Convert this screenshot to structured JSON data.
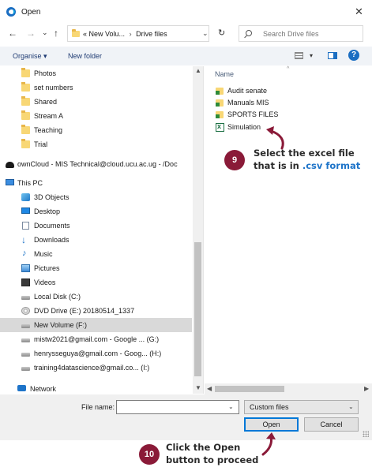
{
  "window": {
    "title": "Open",
    "close_glyph": "✕"
  },
  "nav": {
    "back": "←",
    "forward": "→",
    "recent": "⌄",
    "up": "↑",
    "address_segments": [
      "«",
      "New Volu...",
      "›",
      "Drive files"
    ],
    "refresh": "↻",
    "search_placeholder": "Search Drive files"
  },
  "toolbar": {
    "organise": "Organise ▾",
    "new_folder": "New folder",
    "view_dd": "▾",
    "help": "?"
  },
  "sidebar": {
    "items": [
      {
        "label": "Photos",
        "icon": "folder-icon"
      },
      {
        "label": "set numbers",
        "icon": "folder-icon"
      },
      {
        "label": "Shared",
        "icon": "folder-icon"
      },
      {
        "label": "Stream A",
        "icon": "folder-icon"
      },
      {
        "label": "Teaching",
        "icon": "folder-icon"
      },
      {
        "label": "Trial",
        "icon": "folder-icon"
      },
      {
        "label": "ownCloud - MIS Technical@cloud.ucu.ac.ug - /Doc",
        "icon": "owncloud-icon"
      },
      {
        "label": "This PC",
        "icon": "pc-icon"
      },
      {
        "label": "3D Objects",
        "icon": "3d-objects-icon"
      },
      {
        "label": "Desktop",
        "icon": "desktop-icon"
      },
      {
        "label": "Documents",
        "icon": "documents-icon"
      },
      {
        "label": "Downloads",
        "icon": "downloads-icon"
      },
      {
        "label": "Music",
        "icon": "music-icon"
      },
      {
        "label": "Pictures",
        "icon": "pictures-icon"
      },
      {
        "label": "Videos",
        "icon": "videos-icon"
      },
      {
        "label": "Local Disk (C:)",
        "icon": "local-disk-icon"
      },
      {
        "label": "DVD Drive (E:) 20180514_1337",
        "icon": "dvd-drive-icon"
      },
      {
        "label": "New Volume (F:)",
        "icon": "drive-icon"
      },
      {
        "label": "mistw2021@gmail.com - Google ... (G:)",
        "icon": "drive-icon"
      },
      {
        "label": "henrysseguya@gmail.com - Goog... (H:)",
        "icon": "drive-icon"
      },
      {
        "label": "training4datascience@gmail.co... (I:)",
        "icon": "drive-icon"
      },
      {
        "label": "Network",
        "icon": "network-icon"
      }
    ],
    "selected": "New Volume (F:)"
  },
  "file_list": {
    "column_name": "Name",
    "sort_glyph": "^",
    "files": [
      {
        "label": "Audit senate",
        "icon": "folder-shortcut-icon"
      },
      {
        "label": "Manuals MIS",
        "icon": "folder-shortcut-icon"
      },
      {
        "label": "SPORTS FILES",
        "icon": "folder-shortcut-icon"
      },
      {
        "label": "Simulation",
        "icon": "excel-csv-icon"
      }
    ]
  },
  "footer": {
    "file_name_label": "File name:",
    "file_name_value": "",
    "file_type": "Custom files",
    "open_label": "Open",
    "cancel_label": "Cancel"
  },
  "annotations": {
    "step9_number": "9",
    "step9_line1": "Select the excel file",
    "step9_line2_pre": "that is in ",
    "step9_line2_accent": ".csv format",
    "step10_number": "10",
    "step10_line1": "Click the Open",
    "step10_line2": "button to proceed",
    "badge_color": "#8a1a38",
    "accent_color": "#1e74c9"
  }
}
